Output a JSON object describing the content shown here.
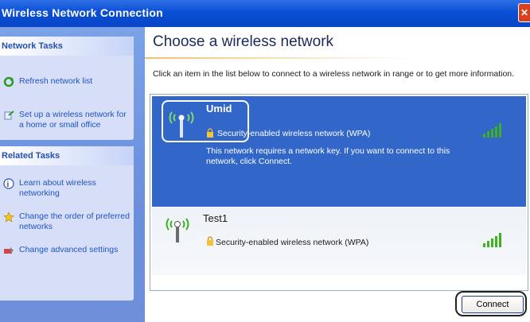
{
  "window": {
    "title": "Wireless Network Connection"
  },
  "sidebar": {
    "network_tasks": {
      "title": "Network Tasks",
      "items": [
        {
          "label": "Refresh network list",
          "icon": "refresh-icon"
        },
        {
          "label": "Set up a wireless network for a home or small office",
          "icon": "setup-network-icon"
        }
      ]
    },
    "related_tasks": {
      "title": "Related Tasks",
      "items": [
        {
          "label": "Learn about wireless networking",
          "icon": "help-icon"
        },
        {
          "label": "Change the order of preferred networks",
          "icon": "star-icon"
        },
        {
          "label": "Change advanced settings",
          "icon": "settings-icon"
        }
      ]
    }
  },
  "main": {
    "heading": "Choose a wireless network",
    "instructions": "Click an item in the list below to connect to a wireless network in range or to get more information.",
    "networks": [
      {
        "name": "Umid",
        "security": "Security-enabled wireless network (WPA)",
        "description": "This network requires a network key. If you want to connect to this network, click Connect.",
        "signal": 4,
        "selected": true
      },
      {
        "name": "Test1",
        "security": "Security-enabled wireless network (WPA)",
        "signal": 4,
        "selected": false
      }
    ],
    "connect_label": "Connect"
  },
  "colors": {
    "titlebar": "#0a4fd4",
    "selected_row": "#3267c9",
    "signal_green": "#3cb21c",
    "link": "#2152c0"
  }
}
